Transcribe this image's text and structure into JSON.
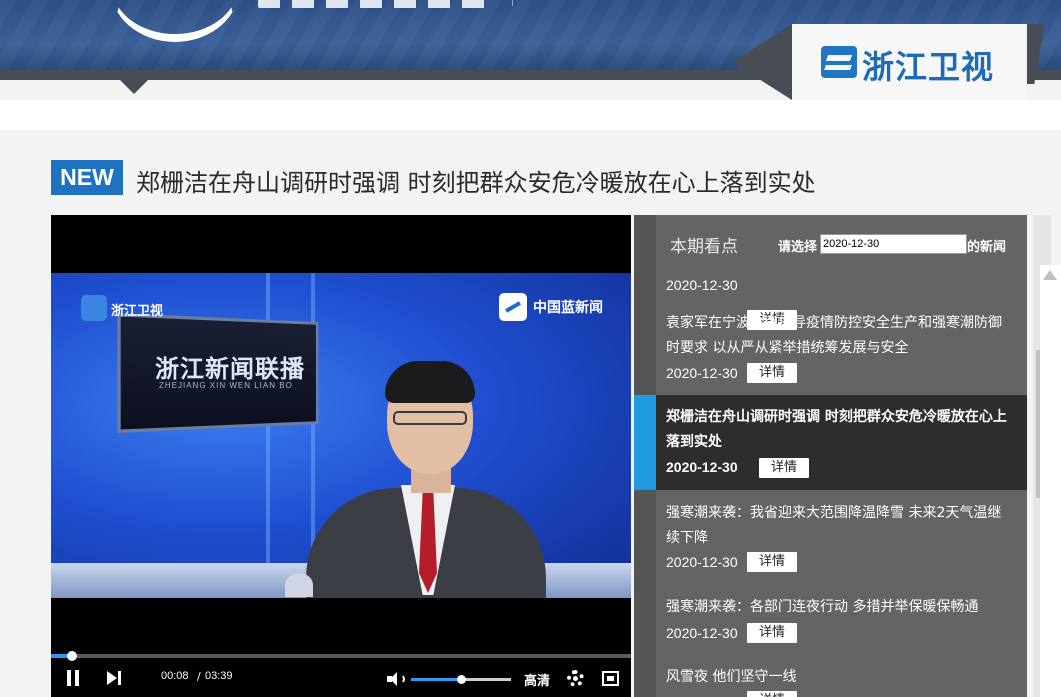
{
  "header": {
    "channel_logo_text": "浙江卫视"
  },
  "article": {
    "badge": "NEW",
    "headline": "郑栅洁在舟山调研时强调 时刻把群众安危冷暖放在心上落到实处"
  },
  "video": {
    "overlay_logo_left": "浙江卫视",
    "overlay_logo_right": "中国蓝新闻",
    "studio_title": "浙江新闻联播",
    "studio_subtitle": "ZHEJIANG XIN WEN LIAN BO",
    "time_current": "00:08",
    "time_separator": "/",
    "time_total": "03:39",
    "progress_fraction": 0.037,
    "volume_fraction": 0.5,
    "quality_label": "高清"
  },
  "sidebar": {
    "heading": "本期看点",
    "date_prompt": "请选择",
    "date_value": "2020-12-30",
    "date_suffix": "的新闻",
    "detail_label": "详情",
    "items": [
      {
        "title": "",
        "date": "2020-12-30",
        "active": false
      },
      {
        "title": "袁家军在宁波检查指导疫情防控安全生产和强寒潮防御时要求 以从严从紧举措统筹发展与安全",
        "date": "2020-12-30",
        "active": false
      },
      {
        "title": "郑栅洁在舟山调研时强调 时刻把群众安危冷暖放在心上落到实处",
        "date": "2020-12-30",
        "active": true
      },
      {
        "title": "强寒潮来袭：我省迎来大范围降温降雪 未来2天气温继续下降",
        "date": "2020-12-30",
        "active": false
      },
      {
        "title": "强寒潮来袭：各部门连夜行动 多措并举保暖保畅通",
        "date": "2020-12-30",
        "active": false
      },
      {
        "title": "风雪夜 他们坚守一线",
        "date": "",
        "active": false
      }
    ]
  },
  "colors": {
    "accent_blue": "#1f72c0",
    "active_marker": "#1f9adf",
    "sidebar_bg": "#646464"
  }
}
